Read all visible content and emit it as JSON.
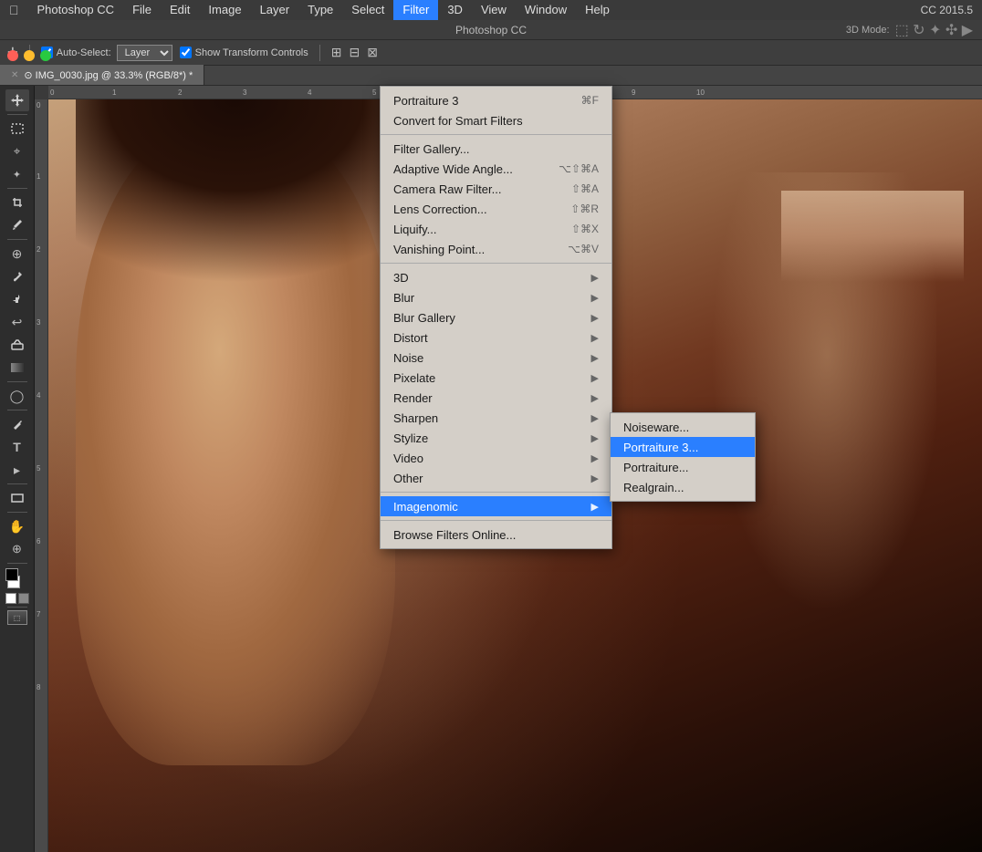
{
  "app": {
    "name": "Photoshop CC",
    "version": "CC 2015.5"
  },
  "menu_bar": {
    "apple_label": "",
    "items": [
      "Photoshop CC",
      "File",
      "Edit",
      "Image",
      "Layer",
      "Type",
      "Select",
      "Filter",
      "3D",
      "View",
      "Window",
      "Help"
    ]
  },
  "active_menu": "Filter",
  "title_bar": {
    "label": "Photoshop CC",
    "right_label": "CC 2015.5",
    "three_d_mode_label": "3D Mode:"
  },
  "options_bar": {
    "auto_select_label": "Auto-Select:",
    "auto_select_value": "Layer",
    "show_transform_label": "Show Transform Controls"
  },
  "tab": {
    "filename": "IMG_0030.jpg @ 33.3% (RGB/8*)",
    "modified": true
  },
  "filter_menu": {
    "top_item_label": "Portraiture 3",
    "top_item_shortcut": "⌘F",
    "items": [
      {
        "label": "Portraiture 3",
        "shortcut": "⌘F",
        "has_submenu": false
      },
      {
        "label": "Convert for Smart Filters",
        "shortcut": "",
        "has_submenu": false
      },
      {
        "sep": true
      },
      {
        "label": "Filter Gallery...",
        "shortcut": "",
        "has_submenu": false
      },
      {
        "label": "Adaptive Wide Angle...",
        "shortcut": "⌥⇧⌘A",
        "has_submenu": false
      },
      {
        "label": "Camera Raw Filter...",
        "shortcut": "⇧⌘A",
        "has_submenu": false
      },
      {
        "label": "Lens Correction...",
        "shortcut": "⇧⌘R",
        "has_submenu": false
      },
      {
        "label": "Liquify...",
        "shortcut": "⇧⌘X",
        "has_submenu": false
      },
      {
        "label": "Vanishing Point...",
        "shortcut": "⌥⌘V",
        "has_submenu": false
      },
      {
        "sep": true
      },
      {
        "label": "3D",
        "shortcut": "",
        "has_submenu": true
      },
      {
        "label": "Blur",
        "shortcut": "",
        "has_submenu": true
      },
      {
        "label": "Blur Gallery",
        "shortcut": "",
        "has_submenu": true
      },
      {
        "label": "Distort",
        "shortcut": "",
        "has_submenu": true
      },
      {
        "label": "Noise",
        "shortcut": "",
        "has_submenu": true
      },
      {
        "label": "Pixelate",
        "shortcut": "",
        "has_submenu": true
      },
      {
        "label": "Render",
        "shortcut": "",
        "has_submenu": true
      },
      {
        "label": "Sharpen",
        "shortcut": "",
        "has_submenu": true
      },
      {
        "label": "Stylize",
        "shortcut": "",
        "has_submenu": true
      },
      {
        "label": "Video",
        "shortcut": "",
        "has_submenu": true
      },
      {
        "label": "Other",
        "shortcut": "",
        "has_submenu": true
      },
      {
        "sep": true
      },
      {
        "label": "Imagenomic",
        "shortcut": "",
        "has_submenu": true,
        "highlighted": true
      },
      {
        "sep": true
      },
      {
        "label": "Browse Filters Online...",
        "shortcut": "",
        "has_submenu": false
      }
    ],
    "imagenomic_submenu": [
      {
        "label": "Noiseware...",
        "highlighted": false
      },
      {
        "label": "Portraiture 3...",
        "highlighted": true
      },
      {
        "label": "Portraiture...",
        "highlighted": false
      },
      {
        "label": "Realgrain...",
        "highlighted": false
      }
    ]
  },
  "toolbar": {
    "tools": [
      {
        "name": "move",
        "icon": "✛"
      },
      {
        "name": "marquee",
        "icon": "▭"
      },
      {
        "name": "lasso",
        "icon": "⌖"
      },
      {
        "name": "quick-select",
        "icon": "✦"
      },
      {
        "name": "crop",
        "icon": "⬚"
      },
      {
        "name": "eyedropper",
        "icon": "🖋"
      },
      {
        "name": "heal",
        "icon": "⊕"
      },
      {
        "name": "brush",
        "icon": "🖌"
      },
      {
        "name": "clone",
        "icon": "✂"
      },
      {
        "name": "history",
        "icon": "↩"
      },
      {
        "name": "eraser",
        "icon": "◻"
      },
      {
        "name": "gradient",
        "icon": "▦"
      },
      {
        "name": "dodge",
        "icon": "◯"
      },
      {
        "name": "pen",
        "icon": "✒"
      },
      {
        "name": "text",
        "icon": "T"
      },
      {
        "name": "path-select",
        "icon": "▸"
      },
      {
        "name": "shape",
        "icon": "▬"
      },
      {
        "name": "hand",
        "icon": "✋"
      },
      {
        "name": "zoom",
        "icon": "⊕"
      }
    ]
  },
  "colors": {
    "menu_bg": "#d4cfc8",
    "menu_active": "#2a7fff",
    "toolbar_bg": "#2d2d2d",
    "options_bg": "#3e3e3e",
    "menubar_bg": "#3a3a3a",
    "workspace_bg": "#535353"
  }
}
